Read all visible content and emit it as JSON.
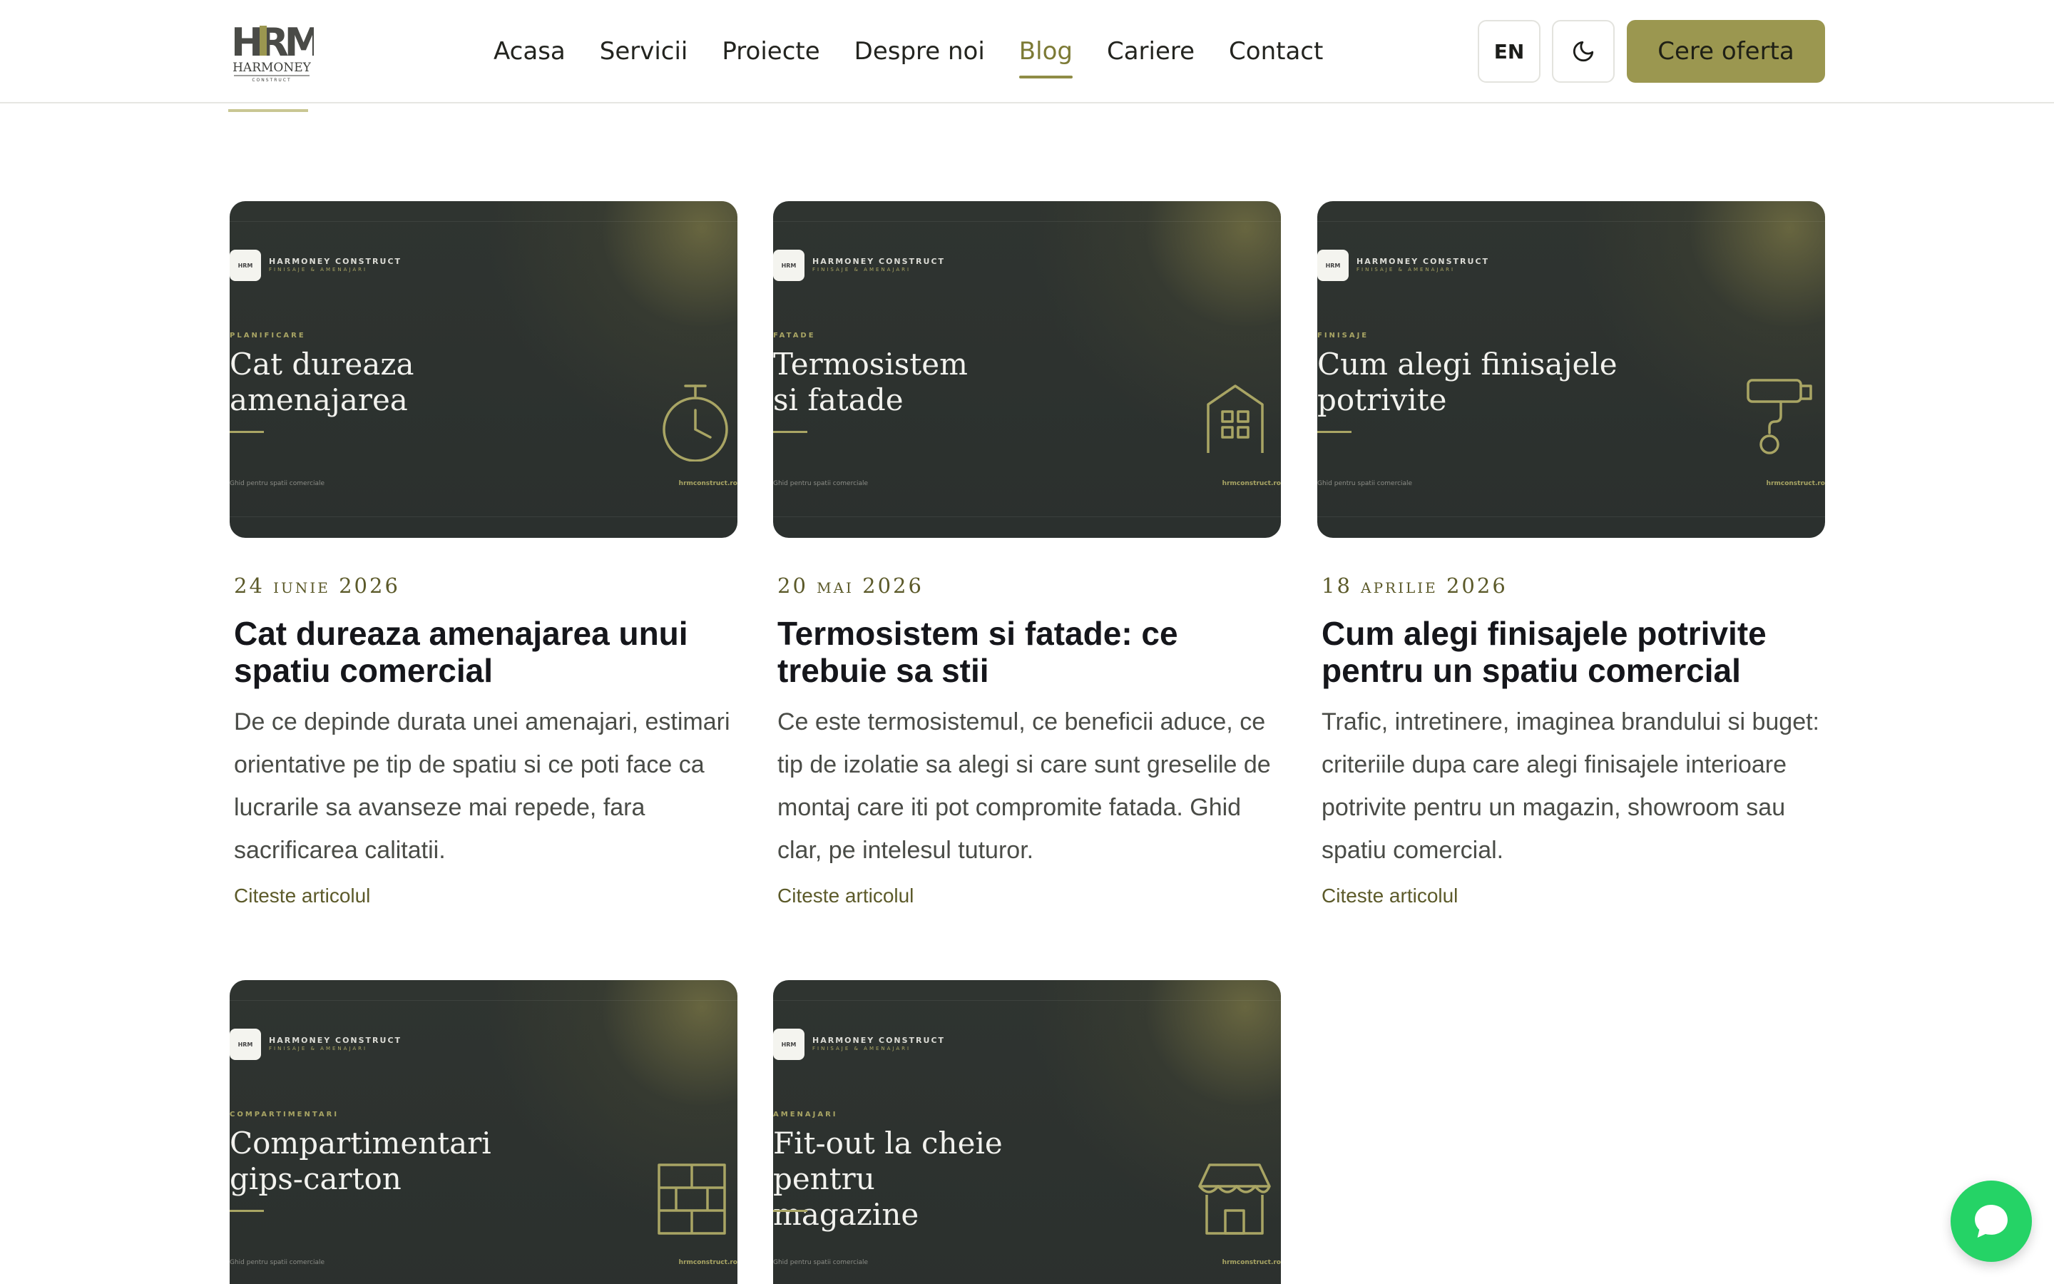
{
  "header": {
    "logo_text": "HRM",
    "logo_sub": "HARMONEY",
    "logo_sub2": "CONSTRUCT",
    "nav": [
      {
        "label": "Acasa"
      },
      {
        "label": "Servicii"
      },
      {
        "label": "Proiecte"
      },
      {
        "label": "Despre noi"
      },
      {
        "label": "Blog",
        "active": true
      },
      {
        "label": "Cariere"
      },
      {
        "label": "Contact"
      }
    ],
    "lang_button": "EN",
    "cta_button": "Cere oferta"
  },
  "thumb_brand": {
    "name": "HARMONEY CONSTRUCT",
    "tagline": "FINISAJE & AMENAJARI",
    "footer_left": "Ghid pentru spatii comerciale",
    "footer_right": "hrmconstruct.ro"
  },
  "posts": [
    {
      "thumb_category": "PLANIFICARE",
      "thumb_title": "Cat dureaza amenajarea",
      "icon": "stopwatch-icon",
      "date": "24 iunie 2026",
      "title": "Cat dureaza amenajarea unui spatiu comercial",
      "excerpt": "De ce depinde durata unei amenajari, estimari orientative pe tip de spatiu si ce poti face ca lucrarile sa avanseze mai repede, fara sacrificarea calitatii.",
      "link": "Citeste articolul"
    },
    {
      "thumb_category": "FATADE",
      "thumb_title": "Termosistem si fatade",
      "icon": "building-icon",
      "date": "20 mai 2026",
      "title": "Termosistem si fatade: ce trebuie sa stii",
      "excerpt": "Ce este termosistemul, ce beneficii aduce, ce tip de izolatie sa alegi si care sunt greselile de montaj care iti pot compromite fatada. Ghid clar, pe intelesul tuturor.",
      "link": "Citeste articolul"
    },
    {
      "thumb_category": "FINISAJE",
      "thumb_title": "Cum alegi finisajele potrivite",
      "icon": "paint-roller-icon",
      "date": "18 aprilie 2026",
      "title": "Cum alegi finisajele potrivite pentru un spatiu comercial",
      "excerpt": "Trafic, intretinere, imaginea brandului si buget: criteriile dupa care alegi finisajele interioare potrivite pentru un magazin, showroom sau spatiu comercial.",
      "link": "Citeste articolul"
    },
    {
      "thumb_category": "COMPARTIMENTARI",
      "thumb_title": "Compartimentari gips-carton",
      "icon": "brick-wall-icon"
    },
    {
      "thumb_category": "AMENAJARI",
      "thumb_title": "Fit-out la cheie pentru magazine",
      "icon": "storefront-icon"
    }
  ],
  "colors": {
    "accent": "#9b9750",
    "accent_dark": "#5c5a2a",
    "thumb_bg": "#2e3330",
    "chat": "#25d366"
  }
}
